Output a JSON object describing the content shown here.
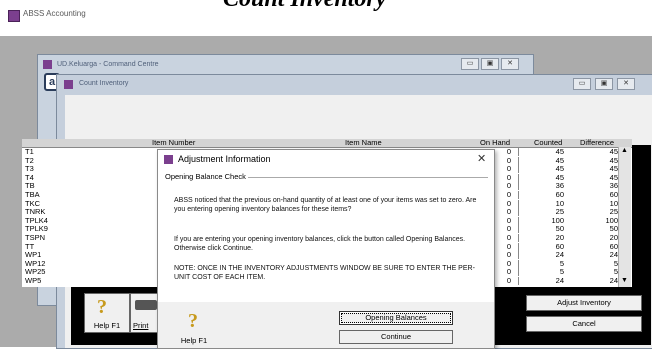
{
  "app": {
    "title": "ABSS Accounting"
  },
  "page_heading": "Count Inventory",
  "command_centre": {
    "title": "UD.Keluarga - Command Centre"
  },
  "count_inventory": {
    "title": "Count Inventory",
    "columns": {
      "item_number": "Item Number",
      "item_name": "Item Name",
      "on_hand": "On Hand",
      "counted": "Counted",
      "difference": "Difference"
    },
    "rows": [
      {
        "num": "T1",
        "on_hand": "0",
        "counted": "45",
        "diff": "45"
      },
      {
        "num": "T2",
        "on_hand": "0",
        "counted": "45",
        "diff": "45"
      },
      {
        "num": "T3",
        "on_hand": "0",
        "counted": "45",
        "diff": "45"
      },
      {
        "num": "T4",
        "on_hand": "0",
        "counted": "45",
        "diff": "45"
      },
      {
        "num": "TB",
        "on_hand": "0",
        "counted": "36",
        "diff": "36"
      },
      {
        "num": "TBA",
        "on_hand": "0",
        "counted": "60",
        "diff": "60"
      },
      {
        "num": "TKC",
        "on_hand": "0",
        "counted": "10",
        "diff": "10"
      },
      {
        "num": "TNRK",
        "on_hand": "0",
        "counted": "25",
        "diff": "25"
      },
      {
        "num": "TPLK4",
        "on_hand": "0",
        "counted": "100",
        "diff": "100"
      },
      {
        "num": "TPLK9",
        "on_hand": "0",
        "counted": "50",
        "diff": "50"
      },
      {
        "num": "TSPN",
        "on_hand": "0",
        "counted": "20",
        "diff": "20"
      },
      {
        "num": "TT",
        "on_hand": "0",
        "counted": "60",
        "diff": "60"
      },
      {
        "num": "WP1",
        "on_hand": "0",
        "counted": "24",
        "diff": "24"
      },
      {
        "num": "WP12",
        "on_hand": "0",
        "counted": "5",
        "diff": "5"
      },
      {
        "num": "WP25",
        "on_hand": "0",
        "counted": "5",
        "diff": "5"
      },
      {
        "num": "WP5",
        "on_hand": "0",
        "counted": "24",
        "diff": "24"
      }
    ],
    "help_label": "Help F1",
    "print_label": "Print",
    "adjust_label": "Adjust Inventory",
    "cancel_label": "Cancel"
  },
  "dialog": {
    "title": "Adjustment Information",
    "close": "✕",
    "section": "Opening Balance Check",
    "para1": "ABSS noticed that the previous on-hand quantity of at least one of your items was set to zero.  Are you entering opening inventory balances for these items?",
    "para2": "If you are entering your opening inventory balances, click the button called Opening Balances.  Otherwise click Continue.",
    "para3": "NOTE:  ONCE IN THE INVENTORY ADJUSTMENTS WINDOW BE SURE TO ENTER THE PER-UNIT COST OF EACH ITEM.",
    "opening_label": "Opening Balances",
    "continue_label": "Continue",
    "help_label": "Help F1"
  },
  "icons": {
    "window": "window-icon",
    "minimize": "minimize-icon",
    "maximize": "maximize-icon",
    "close": "close-icon",
    "help": "help-icon",
    "print": "print-icon"
  }
}
